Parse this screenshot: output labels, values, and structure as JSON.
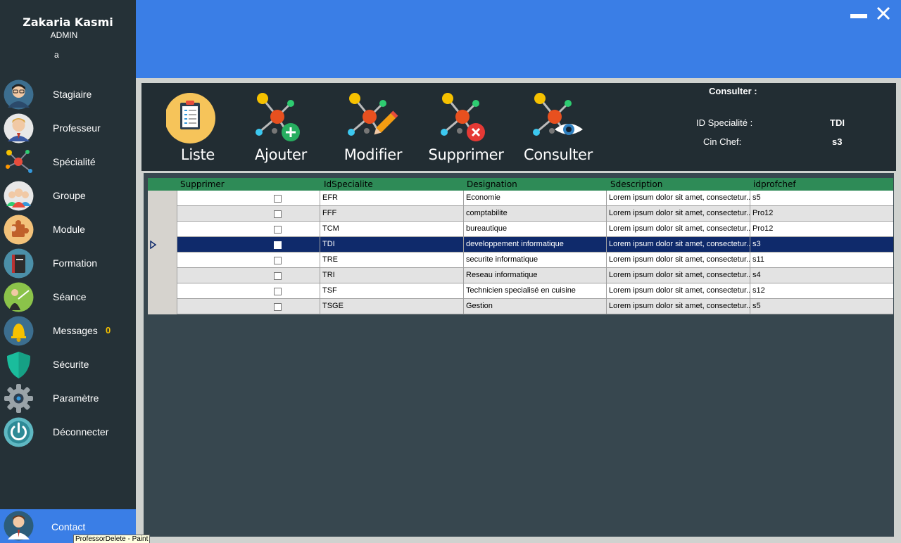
{
  "user": {
    "name": "Zakaria Kasmi",
    "role": "ADMIN",
    "extra": "a"
  },
  "sidebar": {
    "items": [
      {
        "label": "Stagiaire",
        "icon": "student-avatar-icon"
      },
      {
        "label": "Professeur",
        "icon": "professor-avatar-icon"
      },
      {
        "label": "Spécialité",
        "icon": "molecule-icon"
      },
      {
        "label": "Groupe",
        "icon": "group-icon"
      },
      {
        "label": "Module",
        "icon": "puzzle-icon"
      },
      {
        "label": "Formation",
        "icon": "book-icon"
      },
      {
        "label": "Séance",
        "icon": "teacher-board-icon"
      },
      {
        "label": "Messages",
        "icon": "bell-icon",
        "badge": "0"
      },
      {
        "label": "Sécurite",
        "icon": "shield-icon"
      },
      {
        "label": "Paramètre",
        "icon": "gear-icon"
      },
      {
        "label": "Déconnecter",
        "icon": "power-icon"
      }
    ],
    "contact": {
      "label": "Contact",
      "icon": "contact-avatar-icon"
    },
    "tooltip": "ProfessorDelete - Paint"
  },
  "colors": {
    "topbar": "#3a7ee6",
    "sidebar": "#253137",
    "header": "#2e8b57",
    "selected_row": "#0f2a6b",
    "badge": "#f6c100"
  },
  "toolbar": {
    "buttons": [
      {
        "label": "Liste",
        "icon": "clipboard-list-icon"
      },
      {
        "label": "Ajouter",
        "icon": "molecule-add-icon"
      },
      {
        "label": "Modifier",
        "icon": "molecule-edit-icon"
      },
      {
        "label": "Supprimer",
        "icon": "molecule-delete-icon"
      },
      {
        "label": "Consulter",
        "icon": "molecule-view-icon"
      }
    ]
  },
  "consult": {
    "title": "Consulter :",
    "id_label": "ID Specialité :",
    "id_value": "TDI",
    "chef_label": "Cin Chef:",
    "chef_value": "s3"
  },
  "grid": {
    "columns": [
      "Supprimer",
      "IdSpecialite",
      "Designation",
      "Sdescription",
      "idprofchef"
    ],
    "rows": [
      {
        "id": "EFR",
        "designation": "Economie",
        "description": "Lorem ipsum dolor sit amet, consectetur...",
        "chef": "s5"
      },
      {
        "id": "FFF",
        "designation": "comptabilite",
        "description": "Lorem ipsum dolor sit amet, consectetur...",
        "chef": "Pro12"
      },
      {
        "id": "TCM",
        "designation": "bureautique",
        "description": "Lorem ipsum dolor sit amet, consectetur...",
        "chef": "Pro12"
      },
      {
        "id": "TDI",
        "designation": "developpement informatique",
        "description": "Lorem ipsum dolor sit amet, consectetur...",
        "chef": "s3"
      },
      {
        "id": "TRE",
        "designation": "securite informatique",
        "description": "Lorem ipsum dolor sit amet, consectetur...",
        "chef": "s11"
      },
      {
        "id": "TRI",
        "designation": "Reseau informatique",
        "description": "Lorem ipsum dolor sit amet, consectetur...",
        "chef": "s4"
      },
      {
        "id": "TSF",
        "designation": "Technicien specialisé en cuisine",
        "description": "Lorem ipsum dolor sit amet, consectetur...",
        "chef": "s12"
      },
      {
        "id": "TSGE",
        "designation": "Gestion",
        "description": "Lorem ipsum dolor sit amet, consectetur...",
        "chef": "s5"
      }
    ],
    "selected_row": 3
  }
}
